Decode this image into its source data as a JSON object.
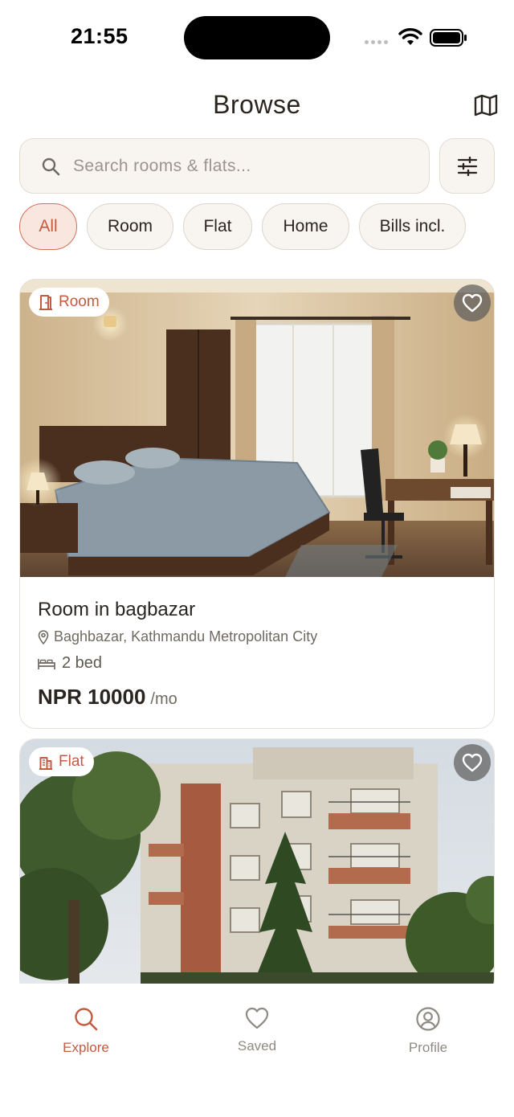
{
  "status": {
    "time": "21:55"
  },
  "header": {
    "title": "Browse",
    "map_icon": "map-icon"
  },
  "search": {
    "placeholder": "Search rooms & flats...",
    "value": ""
  },
  "filters": {
    "chips": [
      {
        "label": "All",
        "active": true
      },
      {
        "label": "Room",
        "active": false
      },
      {
        "label": "Flat",
        "active": false
      },
      {
        "label": "Home",
        "active": false
      },
      {
        "label": "Bills incl.",
        "active": false
      }
    ]
  },
  "listings": [
    {
      "type": "Room",
      "type_icon": "door-icon",
      "title": "Room in bagbazar",
      "location": "Baghbazar, Kathmandu Metropolitan City",
      "beds": "2 bed",
      "price": "NPR 10000",
      "price_unit": "/mo",
      "favorited": false
    },
    {
      "type": "Flat",
      "type_icon": "building-icon",
      "favorited": false
    }
  ],
  "tabbar": {
    "items": [
      {
        "label": "Explore",
        "icon": "search-icon",
        "active": true
      },
      {
        "label": "Saved",
        "icon": "heart-icon",
        "active": false
      },
      {
        "label": "Profile",
        "icon": "user-icon",
        "active": false
      }
    ]
  },
  "colors": {
    "accent": "#c45a3f",
    "chip_active_bg": "#f8e6df",
    "surface": "#f8f5f0"
  }
}
